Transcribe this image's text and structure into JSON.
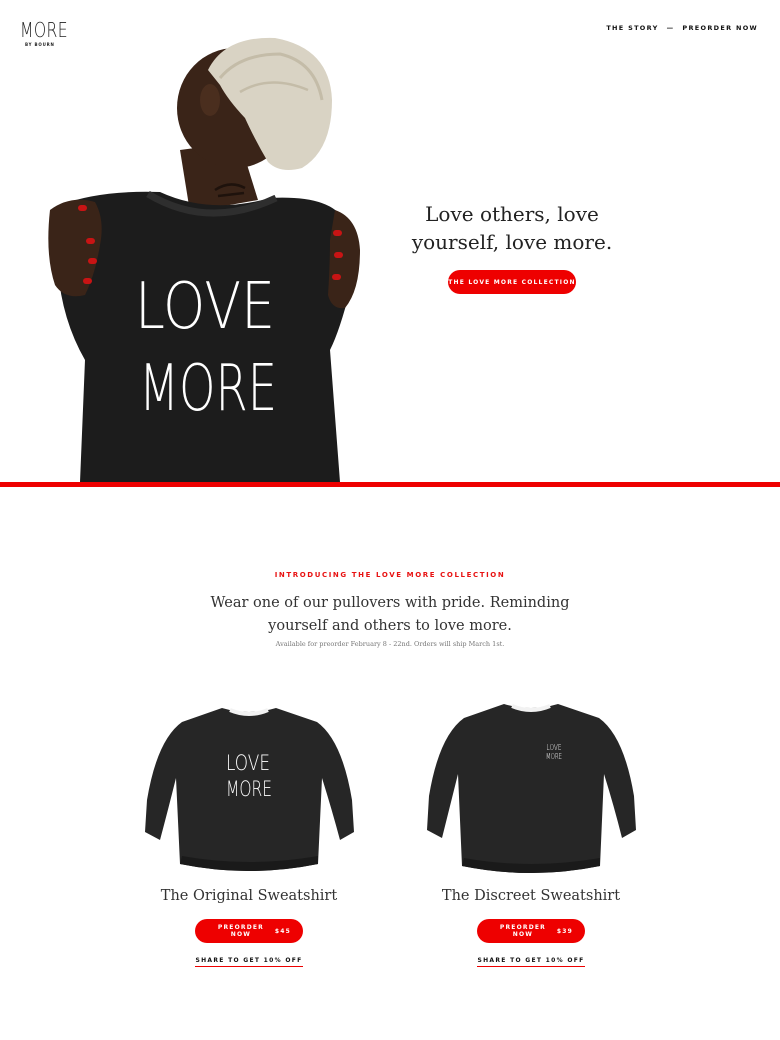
{
  "header": {
    "logo": "MORE",
    "logo_sub": "BY BOURN",
    "nav": {
      "story": "THE STORY",
      "separator": "—",
      "preorder": "PREORDER NOW"
    }
  },
  "hero": {
    "shirt_text_line1": "LOVE",
    "shirt_text_line2": "MORE",
    "tagline": "Love others, love yourself, love more.",
    "cta": "THE LOVE MORE COLLECTION"
  },
  "intro": {
    "eyebrow": "INTRODUCING THE LOVE MORE COLLECTION",
    "text": "Wear one of our pullovers with pride. Reminding yourself and others to love more.",
    "note": "Available for preorder February 8 - 22nd. Orders will ship March 1st."
  },
  "products": [
    {
      "name": "The Original Sweatshirt",
      "print_line1": "LOVE",
      "print_line2": "MORE",
      "button": "PREORDER NOW",
      "price": "$45",
      "share": "SHARE TO GET 10% OFF"
    },
    {
      "name": "The Discreet Sweatshirt",
      "print_line1": "LOVE",
      "print_line2": "MORE",
      "button": "PREORDER NOW",
      "price": "$39",
      "share": "SHARE TO GET 10% OFF"
    }
  ],
  "colors": {
    "accent": "#ee0000",
    "sweatshirt": "#232323",
    "text": "#222222"
  }
}
